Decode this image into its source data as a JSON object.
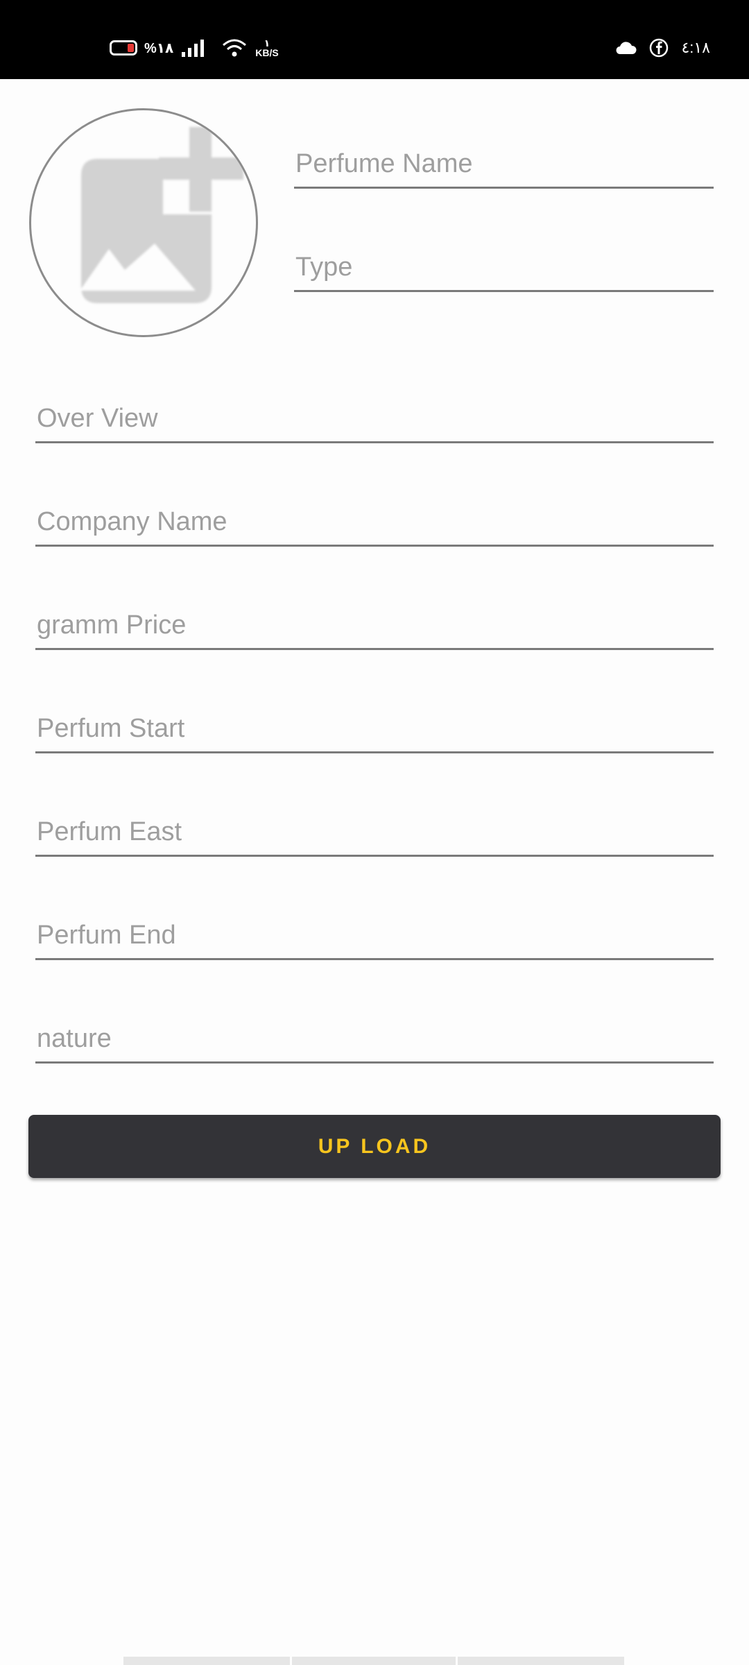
{
  "status_bar": {
    "battery_percent": "%١٨",
    "net_speed_value": "١",
    "net_speed_unit": "KB/S",
    "time": "٤:١٨",
    "icons": [
      "battery-icon",
      "signal-icon",
      "wifi-icon",
      "cloud-icon",
      "facebook-icon"
    ]
  },
  "image_picker": {
    "icon": "add-photo-icon"
  },
  "form": {
    "perfume_name": {
      "placeholder": "Perfume Name",
      "value": ""
    },
    "type": {
      "placeholder": "Type",
      "value": ""
    },
    "overview": {
      "placeholder": "Over View",
      "value": ""
    },
    "company_name": {
      "placeholder": "Company Name",
      "value": ""
    },
    "gramm_price": {
      "placeholder": "gramm Price",
      "value": ""
    },
    "perfum_start": {
      "placeholder": "Perfum Start",
      "value": ""
    },
    "perfum_east": {
      "placeholder": "Perfum East",
      "value": ""
    },
    "perfum_end": {
      "placeholder": "Perfum End",
      "value": ""
    },
    "nature": {
      "placeholder": "nature",
      "value": ""
    }
  },
  "upload_button": {
    "label": "UP LOAD"
  },
  "colors": {
    "button_bg": "#333337",
    "button_text": "#f7c51e",
    "status_bar_bg": "#000000"
  }
}
